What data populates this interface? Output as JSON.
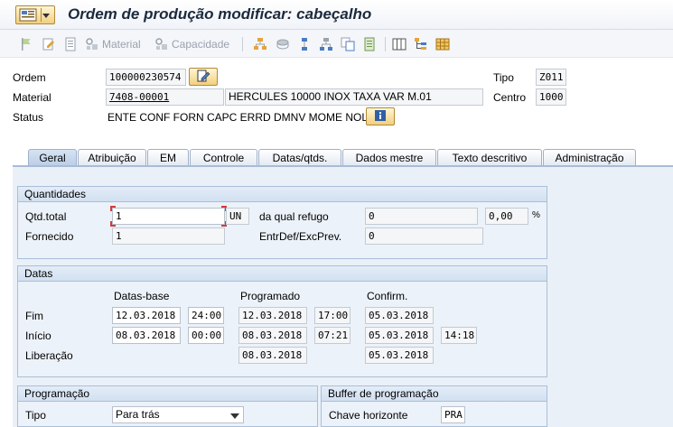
{
  "window": {
    "title": "Ordem de produção modificar: cabeçalho"
  },
  "toolbar": {
    "material_label": "Material",
    "capacity_label": "Capacidade"
  },
  "header": {
    "order_label": "Ordem",
    "order_value": "100000230574",
    "material_label": "Material",
    "material_value": "7408-00001",
    "material_desc": "HERCULES 10000 INOX TAXA VAR M.01",
    "status_label": "Status",
    "status_value": "ENTE CONF FORN CAPC ERRD DMNV MOME NOLQ",
    "type_label": "Tipo",
    "type_value": "Z011",
    "center_label": "Centro",
    "center_value": "1000"
  },
  "tabs": [
    {
      "label": "Geral",
      "active": true
    },
    {
      "label": "Atribuição",
      "active": false
    },
    {
      "label": "EM",
      "active": false
    },
    {
      "label": "Controle",
      "active": false
    },
    {
      "label": "Datas/qtds.",
      "active": false
    },
    {
      "label": "Dados mestre",
      "active": false
    },
    {
      "label": "Texto descritivo",
      "active": false
    },
    {
      "label": "Administração",
      "active": false
    }
  ],
  "quantities": {
    "title": "Quantidades",
    "total_label": "Qtd.total",
    "total_value": "1",
    "unit": "UN",
    "scrap_label": "da qual refugo",
    "scrap_value": "0",
    "scrap_pct": "0,00",
    "pct_sign": "%",
    "delivered_label": "Fornecido",
    "delivered_value": "1",
    "shortfall_label": "EntrDef/ExcPrev.",
    "shortfall_value": "0"
  },
  "dates": {
    "title": "Datas",
    "col_base": "Datas-base",
    "col_scheduled": "Programado",
    "col_confirmed": "Confirm.",
    "end_label": "Fim",
    "start_label": "Início",
    "release_label": "Liberação",
    "end_base_date": "12.03.2018",
    "end_base_time": "24:00",
    "end_sched_date": "12.03.2018",
    "end_sched_time": "17:00",
    "end_conf_date": "05.03.2018",
    "start_base_date": "08.03.2018",
    "start_base_time": "00:00",
    "start_sched_date": "08.03.2018",
    "start_sched_time": "07:21",
    "start_conf_date": "05.03.2018",
    "start_conf_time": "14:18",
    "release_sched_date": "08.03.2018",
    "release_conf_date": "05.03.2018"
  },
  "scheduling": {
    "title": "Programação",
    "type_label": "Tipo",
    "type_value": "Para trás"
  },
  "buffer": {
    "title": "Buffer de programação",
    "horizon_label": "Chave horizonte",
    "horizon_value": "PRA"
  },
  "colors": {
    "title": "#1c2a3d",
    "tab_border": "#9fb0c8",
    "group_bg": "#ecf2f9",
    "required_mark": "#d23c3c"
  }
}
